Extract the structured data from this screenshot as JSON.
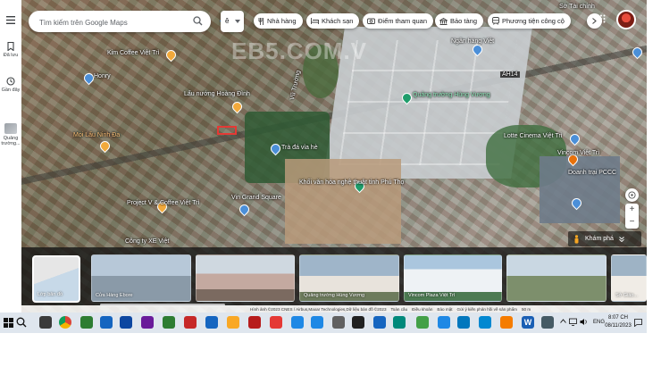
{
  "search": {
    "placeholder": "Tìm kiếm trên Google Maps"
  },
  "lang_button": "ê",
  "chips": [
    {
      "label": "Nhà hàng",
      "icon": "restaurant-icon"
    },
    {
      "label": "Khách sạn",
      "icon": "hotel-icon"
    },
    {
      "label": "Điểm tham quan",
      "icon": "attraction-icon"
    },
    {
      "label": "Bảo tàng",
      "icon": "museum-icon"
    },
    {
      "label": "Phương tiện công cộ",
      "icon": "transit-icon"
    }
  ],
  "sidebar": {
    "items": [
      {
        "label": "",
        "icon": "menu-icon"
      },
      {
        "label": "Đã lưu",
        "icon": "bookmark-icon"
      },
      {
        "label": "Gần đây",
        "icon": "history-icon"
      },
      {
        "label": "Quảng trường...",
        "icon": "recent-place-thumbnail"
      }
    ]
  },
  "watermark": "EB5.COM.V",
  "map_labels": [
    {
      "text": "Kim Coffee Việt Trì",
      "style": ""
    },
    {
      "text": "Honry",
      "style": ""
    },
    {
      "text": "Lẩu nướng Hoàng Đình",
      "style": ""
    },
    {
      "text": "Quảng trường Hùng Vương",
      "style": "green"
    },
    {
      "text": "Vũ Trường",
      "style": ""
    },
    {
      "text": "Trà đá vỉa hè",
      "style": ""
    },
    {
      "text": "Khối văn hóa nghệ thuật tỉnh Phú Thọ",
      "style": ""
    },
    {
      "text": "Lotte Cinema Việt Trì",
      "style": ""
    },
    {
      "text": "Vincom Việt Trì",
      "style": ""
    },
    {
      "text": "Project V & Coffee Việt Trì",
      "style": ""
    },
    {
      "text": "Công ty XE Việt",
      "style": ""
    },
    {
      "text": "Vin Grand Square",
      "style": ""
    },
    {
      "text": "Sở Tài chính",
      "style": ""
    },
    {
      "text": "Ngân hàng Việt",
      "style": ""
    },
    {
      "text": "AH14",
      "style": ""
    },
    {
      "text": "Moi Lẩu Ninh Đa",
      "style": "orange"
    },
    {
      "text": "Doanh trại PCCC",
      "style": ""
    }
  ],
  "explore": {
    "label": "Khám phá"
  },
  "layer_button": {
    "label": "Lớp bản đồ"
  },
  "photos": [
    {
      "caption": "Cửa Hàng Ebore",
      "tone": "#8a9aa8"
    },
    {
      "caption": "",
      "tone": "#b9a9a0"
    },
    {
      "caption": "Quảng trường Hùng Vương",
      "tone": "#9fb5c9"
    },
    {
      "caption": "Vincom Plaza Việt Trì",
      "tone": "#aac6de"
    },
    {
      "caption": "",
      "tone": "#7d8f6c"
    },
    {
      "caption": "Sở Giáo...",
      "tone": "#9eb3c5"
    }
  ],
  "attribution": {
    "text": "Hình ảnh ©2023 CNES / Airbus,Maxar Technologies,Dữ liệu bản đồ ©2023",
    "links": [
      "Toàn cầu",
      "Điều khoản",
      "Bảo mật",
      "Gửi ý kiến phản hồi về sản phẩm"
    ],
    "scale": "50 m"
  },
  "taskbar": {
    "apps": [
      {
        "icon": "search-icon",
        "color": "#1a1a1a"
      },
      {
        "icon": "task-view-icon",
        "color": "#3a3a3a"
      },
      {
        "icon": "chrome-icon",
        "color": "#d44638"
      },
      {
        "icon": "app-icon",
        "color": "#2e7d32"
      },
      {
        "icon": "app-icon",
        "color": "#1565c0"
      },
      {
        "icon": "app-icon",
        "color": "#0d47a1"
      },
      {
        "icon": "app-icon",
        "color": "#6a1b9a"
      },
      {
        "icon": "app-icon",
        "color": "#2e7d32"
      },
      {
        "icon": "app-icon",
        "color": "#c62828"
      },
      {
        "icon": "app-icon",
        "color": "#1565c0"
      },
      {
        "icon": "app-icon",
        "color": "#f9a825"
      },
      {
        "icon": "app-icon",
        "color": "#b71c1c"
      },
      {
        "icon": "app-icon",
        "color": "#e53935"
      },
      {
        "icon": "app-icon",
        "color": "#1e88e5"
      },
      {
        "icon": "app-icon",
        "color": "#1e88e5"
      },
      {
        "icon": "app-icon",
        "color": "#616161"
      },
      {
        "icon": "app-icon",
        "color": "#212121"
      },
      {
        "icon": "app-icon",
        "color": "#1565c0"
      },
      {
        "icon": "app-icon",
        "color": "#00897b"
      },
      {
        "icon": "app-icon",
        "color": "#43a047"
      },
      {
        "icon": "app-icon",
        "color": "#1e88e5"
      },
      {
        "icon": "app-icon",
        "color": "#0277bd"
      },
      {
        "icon": "app-icon",
        "color": "#0288d1"
      },
      {
        "icon": "app-icon",
        "color": "#f57c00"
      },
      {
        "icon": "word-icon",
        "color": "#1a5fb4"
      },
      {
        "icon": "app-icon",
        "color": "#455a64"
      }
    ],
    "lang": "ENG",
    "time": "8:07 CH",
    "date": "08/11/2023"
  }
}
